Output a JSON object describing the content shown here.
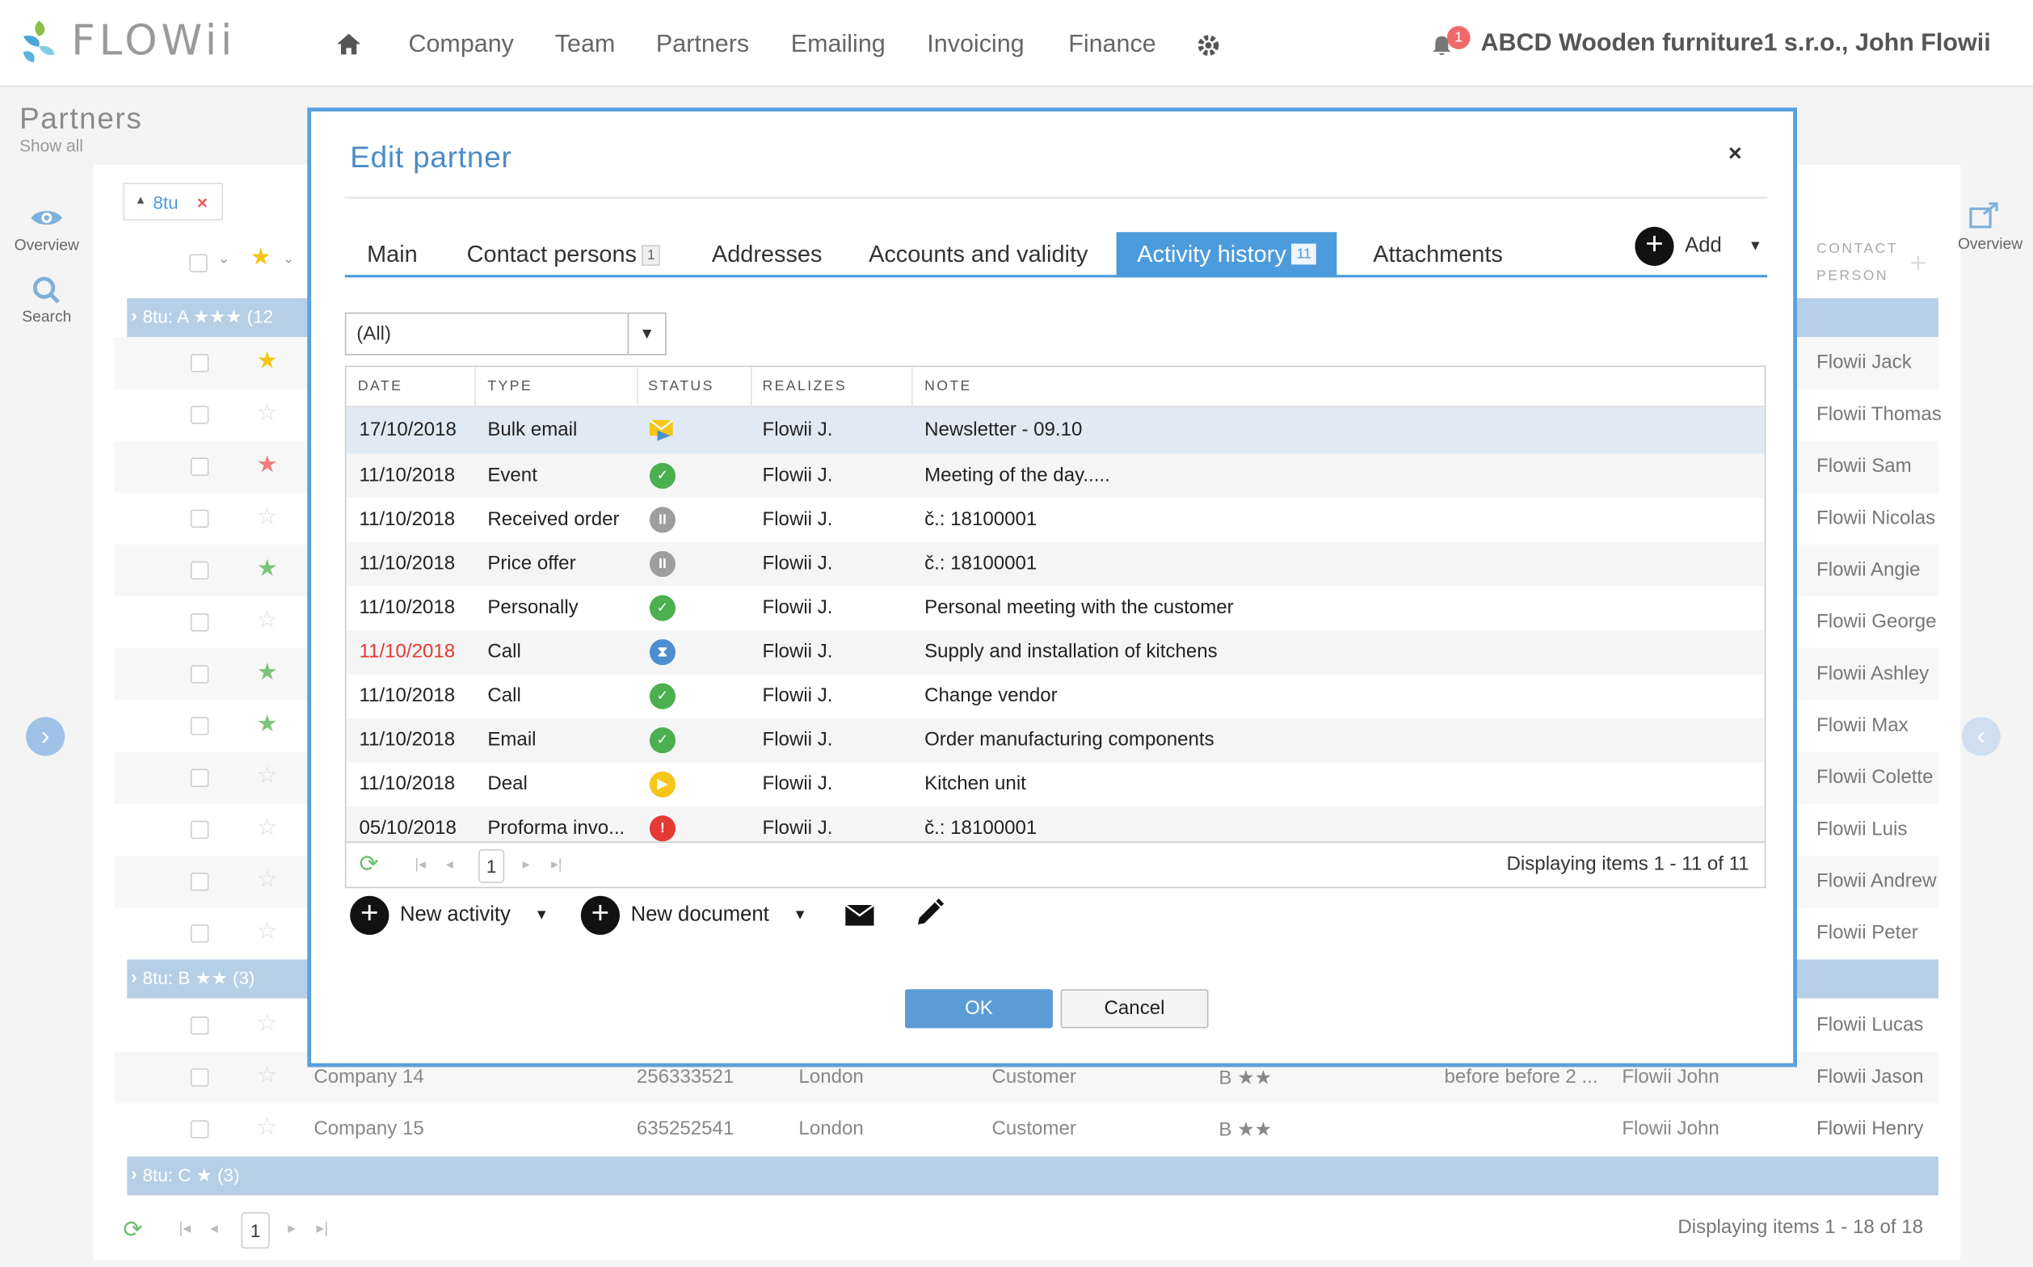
{
  "header": {
    "brand": "FLOWii",
    "nav": [
      "Company",
      "Team",
      "Partners",
      "Emailing",
      "Invoicing",
      "Finance"
    ],
    "notifications": "1",
    "account": "ABCD Wooden furniture1 s.r.o., John Flowii"
  },
  "page": {
    "title": "Partners",
    "subtitle": "Show all",
    "filter_chip": "8tu",
    "side_overview": "Overview",
    "side_search": "Search",
    "right_overview": "Overview",
    "col_contact_1": "CONTACT",
    "col_contact_2": "PERSON",
    "groups": [
      "8tu: A ★★★ (12",
      "8tu: B ★★ (3)",
      "8tu: C ★ (3)"
    ],
    "contacts": [
      "Flowii Jack",
      "Flowii Thomas",
      "Flowii Sam",
      "Flowii Nicolas",
      "Flowii Angie",
      "Flowii George",
      "Flowii Ashley",
      "Flowii Max",
      "Flowii Colette",
      "Flowii Luis",
      "Flowii Andrew",
      "Flowii Peter"
    ],
    "contacts_b": [
      "Flowii Lucas",
      "Flowii Jason",
      "Flowii Henry"
    ],
    "row14": {
      "name": "Company 14",
      "id": "256333521",
      "city": "London",
      "type": "Customer",
      "rating": "B ★★",
      "note": "before before 2 ...",
      "owner": "Flowii John"
    },
    "row15": {
      "name": "Company 15",
      "id": "635252541",
      "city": "London",
      "type": "Customer",
      "rating": "B ★★",
      "owner": "Flowii John"
    },
    "pager_page": "1",
    "pager_text": "Displaying items 1 - 18 of 18"
  },
  "modal": {
    "title": "Edit partner",
    "close": "×",
    "tabs": {
      "main": "Main",
      "contacts": "Contact persons",
      "contacts_count": "1",
      "addresses": "Addresses",
      "accounts": "Accounts and validity",
      "activity": "Activity history",
      "activity_count": "11",
      "attachments": "Attachments"
    },
    "add_label": "Add",
    "filter_value": "(All)",
    "columns": {
      "date": "DATE",
      "type": "TYPE",
      "status": "STATUS",
      "realizes": "REALIZES",
      "note": "NOTE"
    },
    "rows": [
      {
        "date": "17/10/2018",
        "type": "Bulk email",
        "status": "bulk-email-status",
        "realizes": "Flowii J.",
        "note": "Newsletter - 09.10"
      },
      {
        "date": "11/10/2018",
        "type": "Event",
        "status": "done",
        "realizes": "Flowii J.",
        "note": "Meeting of the day....."
      },
      {
        "date": "11/10/2018",
        "type": "Received order",
        "status": "paused",
        "realizes": "Flowii J.",
        "note": "č.: 18100001"
      },
      {
        "date": "11/10/2018",
        "type": "Price offer",
        "status": "paused",
        "realizes": "Flowii J.",
        "note": "č.: 18100001"
      },
      {
        "date": "11/10/2018",
        "type": "Personally",
        "status": "done",
        "realizes": "Flowii J.",
        "note": "Personal meeting with the customer"
      },
      {
        "date": "11/10/2018",
        "type": "Call",
        "status": "waiting",
        "realizes": "Flowii J.",
        "note": "Supply and installation of kitchens"
      },
      {
        "date": "11/10/2018",
        "type": "Call",
        "status": "done",
        "realizes": "Flowii J.",
        "note": "Change vendor"
      },
      {
        "date": "11/10/2018",
        "type": "Email",
        "status": "done",
        "realizes": "Flowii J.",
        "note": "Order manufacturing components"
      },
      {
        "date": "11/10/2018",
        "type": "Deal",
        "status": "in-progress",
        "realizes": "Flowii J.",
        "note": "Kitchen unit"
      },
      {
        "date": "05/10/2018",
        "type": "Proforma invo...",
        "status": "overdue",
        "realizes": "Flowii J.",
        "note": "č.: 18100001"
      }
    ],
    "pager_page": "1",
    "pager_text": "Displaying items 1 - 11 of 11",
    "new_activity": "New activity",
    "new_document": "New document",
    "ok": "OK",
    "cancel": "Cancel",
    "colors": {
      "accent": "#4c9bdc",
      "done": "#4caf50",
      "paused": "#9e9e9e",
      "waiting": "#4c8fd0",
      "in_progress": "#f5c518",
      "overdue": "#e53935",
      "overdue_date": "#e53935"
    }
  }
}
